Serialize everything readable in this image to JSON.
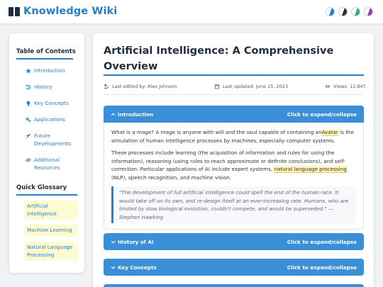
{
  "header": {
    "logo_icon": "book-icon",
    "title": "Knowledge Wiki",
    "themes": [
      {
        "name": "theme-blue",
        "fg": "#1e7fd3",
        "bg": "#ffffff"
      },
      {
        "name": "theme-dark",
        "fg": "#1f2d3d",
        "bg": "#ffffff"
      },
      {
        "name": "theme-green",
        "fg": "#2bb36b",
        "bg": "#ffffff"
      },
      {
        "name": "theme-purple",
        "fg": "#8e44ad",
        "bg": "#ffffff"
      }
    ]
  },
  "sidebar": {
    "toc_title": "Table of Contents",
    "toc": [
      {
        "label": "Introduction",
        "icon": "star-icon"
      },
      {
        "label": "History",
        "icon": "history-icon"
      },
      {
        "label": "Key Concepts",
        "icon": "lightbulb-icon"
      },
      {
        "label": "Applications",
        "icon": "gears-icon"
      },
      {
        "label": "Future Developments",
        "icon": "rocket-icon"
      },
      {
        "label": "Additional Resources",
        "icon": "link-icon"
      }
    ],
    "glossary_title": "Quick Glossary",
    "glossary": [
      {
        "label": "Artificial Intelligence"
      },
      {
        "label": "Machine Learning"
      },
      {
        "label": "Natural Language Processing"
      }
    ]
  },
  "article": {
    "title": "Artificial Intelligence: A Comprehensive Overview",
    "meta": {
      "author": "Last edited by: Alex Johnson",
      "updated": "Last updated: June 15, 2023",
      "views": "Views: 12,847"
    },
    "sections": [
      {
        "title": "Introduction",
        "toggle": "Click to expand/collapse",
        "expanded": true,
        "p1_before": "What is a mage? A mage is anyone with will and the soul capable of containing an",
        "p1_highlight": "Avatar",
        "p1_after": " is the simulation of human intelligence processes by machines, especially computer systems.",
        "p2_before": "These processes include learning (the acquisition of information and rules for using the information), reasoning (using rules to reach approximate or definite conclusions), and self-correction. Particular applications of AI include expert systems, ",
        "p2_highlight": "natural language processing",
        "p2_after": " (NLP), speech recognition, and machine vision.",
        "quote": "\"The development of full artificial intelligence could spell the end of the human race. It would take off on its own, and re-design itself at an ever-increasing rate. Humans, who are limited by slow biological evolution, couldn't compete, and would be superseded.\" — Stephen Hawking"
      },
      {
        "title": "History of AI",
        "toggle": "Click to expand/collapse",
        "expanded": false
      },
      {
        "title": "Key Concepts",
        "toggle": "Click to expand/collapse",
        "expanded": false
      }
    ]
  },
  "colors": {
    "accent": "#2a7ec6",
    "section_header": "#3a8fd6",
    "highlight": "#fff5b8",
    "glossary_bg": "#fdfbd2"
  }
}
